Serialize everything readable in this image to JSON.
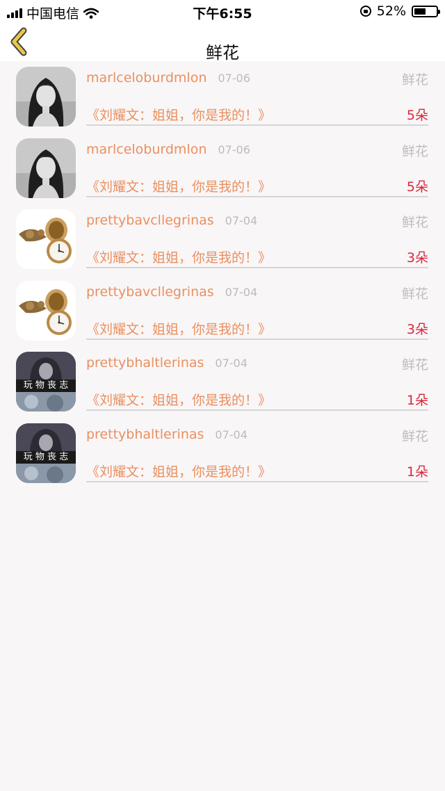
{
  "status_bar": {
    "carrier": "中国电信",
    "time": "下午6:55",
    "battery_percent": "52%",
    "battery_level": 0.52
  },
  "nav": {
    "title": "鲜花",
    "back_icon": "chevron-left-icon",
    "accent_color": "#e9c84a"
  },
  "colors": {
    "name": "#e99060",
    "count": "#d8283e",
    "muted": "#bdbdbd"
  },
  "gifts": [
    {
      "username": "marlceloburdmlon",
      "date": "07-06",
      "category": "鲜花",
      "book": "《刘耀文：姐姐，你是我的！》",
      "count": "5朵",
      "avatar": "girl-portrait"
    },
    {
      "username": "marlceloburdmlon",
      "date": "07-06",
      "category": "鲜花",
      "book": "《刘耀文：姐姐，你是我的！》",
      "count": "5朵",
      "avatar": "girl-portrait"
    },
    {
      "username": "prettybavcllegrinas",
      "date": "07-04",
      "category": "鲜花",
      "book": "《刘耀文：姐姐，你是我的！》",
      "count": "3朵",
      "avatar": "pocket-watch"
    },
    {
      "username": "prettybavcllegrinas",
      "date": "07-04",
      "category": "鲜花",
      "book": "《刘耀文：姐姐，你是我的！》",
      "count": "3朵",
      "avatar": "pocket-watch"
    },
    {
      "username": "prettybhaltlerinas",
      "date": "07-04",
      "category": "鲜花",
      "book": "《刘耀文：姐姐，你是我的！》",
      "count": "1朵",
      "avatar": "text-overlay",
      "avatar_text": "玩 物 丧 志"
    },
    {
      "username": "prettybhaltlerinas",
      "date": "07-04",
      "category": "鲜花",
      "book": "《刘耀文：姐姐，你是我的！》",
      "count": "1朵",
      "avatar": "text-overlay",
      "avatar_text": "玩 物 丧 志"
    }
  ]
}
